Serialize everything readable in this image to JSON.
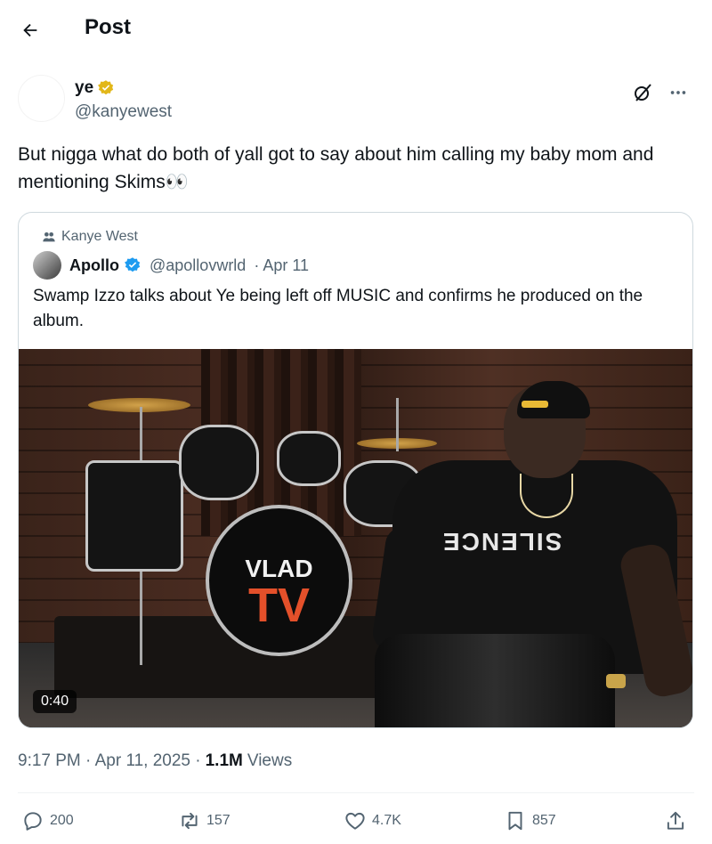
{
  "header": {
    "title": "Post",
    "back_icon": "arrow-left-icon"
  },
  "post": {
    "author_name": "ye",
    "author_handle": "@kanyewest",
    "verified_color": "#e2b719",
    "text": "But nigga what do both of yall got to say about him calling my baby mom and mentioning Skims👀",
    "timestamp": "9:17 PM · Apr 11, 2025 ·",
    "views_count": "1.1M",
    "views_label": "Views"
  },
  "quote": {
    "context": "Kanye West",
    "author_name": "Apollo",
    "author_handle": "@apollovwrld",
    "date": "· Apr 11",
    "text": "Swamp Izzo talks about Ye being left off MUSIC and confirms he produced on the album.",
    "video_duration": "0:40",
    "video_logo_top": "VLAD",
    "video_logo_bottom": "TV",
    "shirt_text": "SILENCE",
    "verified_color": "#1d9bf0"
  },
  "actions": {
    "replies": "200",
    "reposts": "157",
    "likes": "4.7K",
    "bookmarks": "857"
  }
}
